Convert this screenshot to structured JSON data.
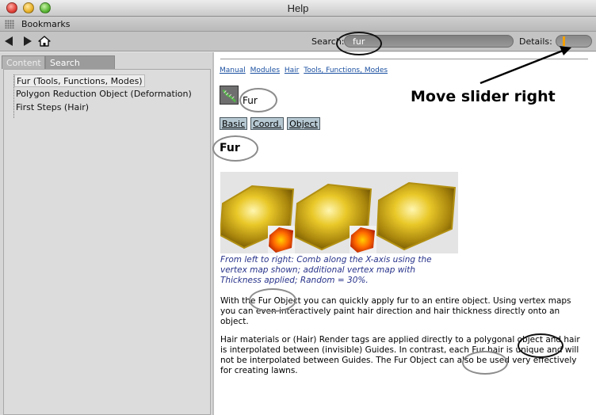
{
  "window": {
    "title": "Help"
  },
  "bookmarks": {
    "label": "Bookmarks"
  },
  "toolbar": {
    "back_icon": "back-arrow-icon",
    "forward_icon": "forward-arrow-icon",
    "home_icon": "home-icon",
    "search_label": "Search:",
    "search_value": "fur",
    "details_label": "Details:",
    "details_level": 0.2
  },
  "sidebar": {
    "tabs": [
      {
        "label": "Content",
        "active": false
      },
      {
        "label": "Search Results",
        "active": true
      }
    ],
    "items": [
      {
        "label": "Fur (Tools, Functions, Modes)",
        "selected": true
      },
      {
        "label": "Polygon Reduction Object (Deformation)",
        "selected": false
      },
      {
        "label": "First Steps (Hair)",
        "selected": false
      }
    ]
  },
  "content": {
    "breadcrumb": [
      "Manual",
      "Modules",
      "Hair",
      "Tools, Functions, Modes"
    ],
    "icon_title": "Fur",
    "tab_buttons": [
      "Basic",
      "Coord.",
      "Object"
    ],
    "heading": "Fur",
    "caption": "From left to right: Comb along the X-axis using the vertex map shown; additional vertex map with Thickness applied; Random = 30%.",
    "paragraph1": "With the Fur Object you can quickly apply fur to an entire object. Using vertex maps you can even interactively paint hair direction and hair thickness directly onto an object.",
    "paragraph2": "Hair materials or (Hair) Render tags are applied directly to a polygonal object and hair is interpolated between (invisible) Guides. In contrast, each Fur hair is unique and will not be interpolated between Guides. The Fur Object can also be used very effectively for creating lawns."
  },
  "annotation": {
    "text": "Move slider right"
  },
  "colors": {
    "link": "#1a4fa0",
    "caption": "#27328a",
    "slider_thumb": "#f2a000",
    "fur_yellow": "#d8b41a"
  }
}
